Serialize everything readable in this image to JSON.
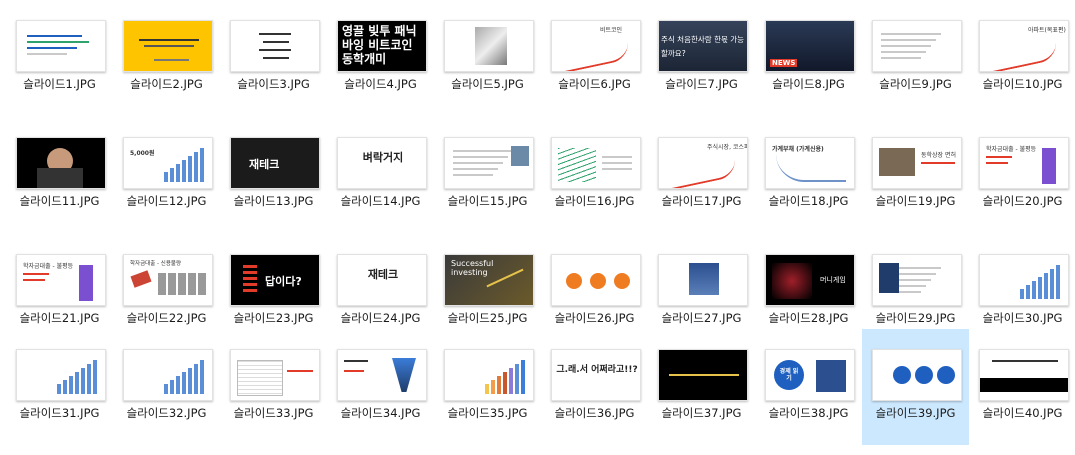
{
  "files": [
    {
      "name": "슬라이드1.JPG",
      "thumb": {
        "bg": "#ffffff",
        "text": "",
        "style": "doc-blue"
      }
    },
    {
      "name": "슬라이드2.JPG",
      "thumb": {
        "bg": "#ffc400",
        "text": "",
        "style": "yellow"
      }
    },
    {
      "name": "슬라이드3.JPG",
      "thumb": {
        "bg": "#ffffff",
        "text": "",
        "style": "list"
      }
    },
    {
      "name": "슬라이드4.JPG",
      "thumb": {
        "bg": "#000000",
        "text": "영끌 빚투 패닉바잉 비트코인 동학개미",
        "style": "big-white"
      }
    },
    {
      "name": "슬라이드5.JPG",
      "thumb": {
        "bg": "#ffffff",
        "text": "",
        "style": "photo-center"
      }
    },
    {
      "name": "슬라이드6.JPG",
      "thumb": {
        "bg": "#ffffff",
        "text": "비트코인",
        "style": "red-line"
      }
    },
    {
      "name": "슬라이드7.JPG",
      "thumb": {
        "bg": "#1a2a44",
        "text": "주식 처음한사람 한몫 가능할까요?",
        "style": "photo-caption"
      }
    },
    {
      "name": "슬라이드8.JPG",
      "thumb": {
        "bg": "#23324a",
        "text": "NEWS",
        "style": "news"
      }
    },
    {
      "name": "슬라이드9.JPG",
      "thumb": {
        "bg": "#ffffff",
        "text": "",
        "style": "doc-text"
      }
    },
    {
      "name": "슬라이드10.JPG",
      "thumb": {
        "bg": "#ffffff",
        "text": "아파트(목표편)",
        "style": "red-line"
      }
    },
    {
      "name": "슬라이드11.JPG",
      "thumb": {
        "bg": "#000000",
        "text": "",
        "style": "video"
      }
    },
    {
      "name": "슬라이드12.JPG",
      "thumb": {
        "bg": "#ffffff",
        "text": "5,000원",
        "style": "bars"
      }
    },
    {
      "name": "슬라이드13.JPG",
      "thumb": {
        "bg": "#1b1b1b",
        "text": "재테크",
        "style": "dark-word"
      }
    },
    {
      "name": "슬라이드14.JPG",
      "thumb": {
        "bg": "#ffffff",
        "text": "벼락거지",
        "style": "center-word"
      }
    },
    {
      "name": "슬라이드15.JPG",
      "thumb": {
        "bg": "#ffffff",
        "text": "",
        "style": "doc-photo"
      }
    },
    {
      "name": "슬라이드16.JPG",
      "thumb": {
        "bg": "#ffffff",
        "text": "",
        "style": "green-lines"
      }
    },
    {
      "name": "슬라이드17.JPG",
      "thumb": {
        "bg": "#ffffff",
        "text": "주식시장, 코스피",
        "style": "red-line"
      }
    },
    {
      "name": "슬라이드18.JPG",
      "thumb": {
        "bg": "#ffffff",
        "text": "가계부채 (가계신용)",
        "style": "rise"
      }
    },
    {
      "name": "슬라이드19.JPG",
      "thumb": {
        "bg": "#ffffff",
        "text": "동학상장 면허",
        "style": "photo-left"
      }
    },
    {
      "name": "슬라이드20.JPG",
      "thumb": {
        "bg": "#ffffff",
        "text": "학자금대출 - 불평등",
        "style": "purple-bar"
      }
    },
    {
      "name": "슬라이드21.JPG",
      "thumb": {
        "bg": "#ffffff",
        "text": "학자금대출 - 불평등",
        "style": "purple-bar"
      }
    },
    {
      "name": "슬라이드22.JPG",
      "thumb": {
        "bg": "#ffffff",
        "text": "학자금대출 - 신용불량",
        "style": "cards"
      }
    },
    {
      "name": "슬라이드23.JPG",
      "thumb": {
        "bg": "#000000",
        "text": "답이다?",
        "style": "dark-answer"
      }
    },
    {
      "name": "슬라이드24.JPG",
      "thumb": {
        "bg": "#ffffff",
        "text": "재테크",
        "style": "center-word"
      }
    },
    {
      "name": "슬라이드25.JPG",
      "thumb": {
        "bg": "#2b2b2b",
        "text": "Successful investing",
        "style": "invest"
      }
    },
    {
      "name": "슬라이드26.JPG",
      "thumb": {
        "bg": "#ffffff",
        "text": "",
        "style": "circles-orange"
      }
    },
    {
      "name": "슬라이드27.JPG",
      "thumb": {
        "bg": "#ffffff",
        "text": "",
        "style": "bank"
      }
    },
    {
      "name": "슬라이드28.JPG",
      "thumb": {
        "bg": "#000000",
        "text": "머니게임",
        "style": "dark-red"
      }
    },
    {
      "name": "슬라이드29.JPG",
      "thumb": {
        "bg": "#ffffff",
        "text": "",
        "style": "book"
      }
    },
    {
      "name": "슬라이드30.JPG",
      "thumb": {
        "bg": "#ffffff",
        "text": "",
        "style": "bars"
      }
    },
    {
      "name": "슬라이드31.JPG",
      "thumb": {
        "bg": "#ffffff",
        "text": "",
        "style": "bars"
      }
    },
    {
      "name": "슬라이드32.JPG",
      "thumb": {
        "bg": "#ffffff",
        "text": "",
        "style": "bars"
      }
    },
    {
      "name": "슬라이드33.JPG",
      "thumb": {
        "bg": "#ffffff",
        "text": "",
        "style": "table"
      }
    },
    {
      "name": "슬라이드34.JPG",
      "thumb": {
        "bg": "#ffffff",
        "text": "",
        "style": "funnel"
      }
    },
    {
      "name": "슬라이드35.JPG",
      "thumb": {
        "bg": "#ffffff",
        "text": "",
        "style": "bars-color"
      }
    },
    {
      "name": "슬라이드36.JPG",
      "thumb": {
        "bg": "#ffffff",
        "text": "그.래.서 어쩌라고!!?",
        "style": "center-word2"
      }
    },
    {
      "name": "슬라이드37.JPG",
      "thumb": {
        "bg": "#000000",
        "text": "",
        "style": "black-strip"
      }
    },
    {
      "name": "슬라이드38.JPG",
      "thumb": {
        "bg": "#ffffff",
        "text": "경제 읽기",
        "style": "blue-circle"
      }
    },
    {
      "name": "슬라이드39.JPG",
      "thumb": {
        "bg": "#ffffff",
        "text": "",
        "style": "three-circles"
      }
    },
    {
      "name": "슬라이드40.JPG",
      "thumb": {
        "bg": "#ffffff",
        "text": "",
        "style": "black-band"
      }
    }
  ],
  "selected_index": 38,
  "colors": {
    "selection": "#cce8ff",
    "accent_red": "#e23b2a",
    "accent_blue": "#1f5fbf",
    "accent_orange": "#f07c21"
  }
}
